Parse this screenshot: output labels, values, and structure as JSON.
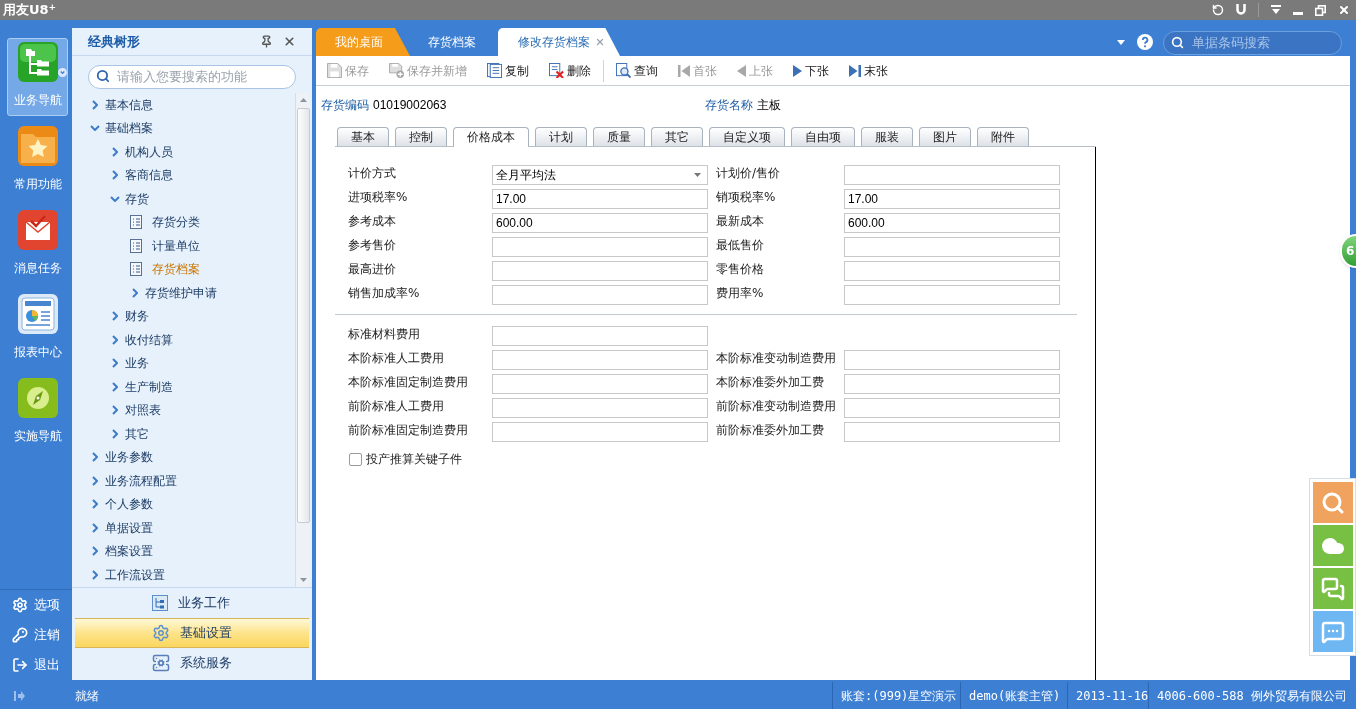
{
  "app": {
    "logo": "用友U8$^{+}$"
  },
  "nav": [
    {
      "label": "业务导航",
      "kind": "business",
      "selected": true
    },
    {
      "label": "常用功能",
      "kind": "favorites",
      "selected": false
    },
    {
      "label": "消息任务",
      "kind": "messages",
      "selected": false
    },
    {
      "label": "报表中心",
      "kind": "reports",
      "selected": false
    },
    {
      "label": "实施导航",
      "kind": "guide",
      "selected": false
    }
  ],
  "nav_bottom": [
    {
      "label": "选项",
      "kind": "options"
    },
    {
      "label": "注销",
      "kind": "logout"
    },
    {
      "label": "退出",
      "kind": "exit"
    }
  ],
  "sidebar": {
    "title": "经典树形",
    "search": {
      "placeholder": "请输入您要搜索的功能"
    },
    "tree": [
      {
        "label": "基本信息",
        "kind": "folder",
        "expanded": false,
        "selected": false
      },
      {
        "label": "基础档案",
        "kind": "folder",
        "expanded": true,
        "selected": false,
        "children": [
          {
            "label": "机构人员",
            "kind": "folder",
            "expanded": false,
            "selected": false
          },
          {
            "label": "客商信息",
            "kind": "folder",
            "expanded": false,
            "selected": false
          },
          {
            "label": "存货",
            "kind": "folder",
            "expanded": true,
            "selected": false,
            "children": [
              {
                "label": "存货分类",
                "kind": "page",
                "selected": false
              },
              {
                "label": "计量单位",
                "kind": "page",
                "selected": false
              },
              {
                "label": "存货档案",
                "kind": "page",
                "selected": true
              },
              {
                "label": "存货维护申请",
                "kind": "folder",
                "expanded": false,
                "selected": false
              }
            ]
          },
          {
            "label": "财务",
            "kind": "folder",
            "expanded": false,
            "selected": false
          },
          {
            "label": "收付结算",
            "kind": "folder",
            "expanded": false,
            "selected": false
          },
          {
            "label": "业务",
            "kind": "folder",
            "expanded": false,
            "selected": false
          },
          {
            "label": "生产制造",
            "kind": "folder",
            "expanded": false,
            "selected": false
          },
          {
            "label": "对照表",
            "kind": "folder",
            "expanded": false,
            "selected": false
          },
          {
            "label": "其它",
            "kind": "folder",
            "expanded": false,
            "selected": false
          }
        ]
      },
      {
        "label": "业务参数",
        "kind": "folder",
        "expanded": false,
        "selected": false
      },
      {
        "label": "业务流程配置",
        "kind": "folder",
        "expanded": false,
        "selected": false
      },
      {
        "label": "个人参数",
        "kind": "folder",
        "expanded": false,
        "selected": false
      },
      {
        "label": "单据设置",
        "kind": "folder",
        "expanded": false,
        "selected": false
      },
      {
        "label": "档案设置",
        "kind": "folder",
        "expanded": false,
        "selected": false
      },
      {
        "label": "工作流设置",
        "kind": "folder",
        "expanded": false,
        "selected": false
      }
    ],
    "sections": [
      {
        "label": "业务工作",
        "kind": "work",
        "selected": false
      },
      {
        "label": "基础设置",
        "kind": "settings",
        "selected": true
      },
      {
        "label": "系统服务",
        "kind": "service",
        "selected": false
      }
    ]
  },
  "tabs": [
    {
      "label": "我的桌面",
      "kind": "home",
      "selected": false
    },
    {
      "label": "存货档案",
      "kind": "page",
      "selected": false
    },
    {
      "label": "修改存货档案",
      "kind": "page",
      "selected": true,
      "closable": true
    }
  ],
  "bill_search": {
    "placeholder": "单据条码搜索"
  },
  "toolbar": {
    "groups": [
      [
        {
          "label": "保存",
          "kind": "save",
          "disabled": true
        },
        {
          "label": "保存并新增",
          "kind": "save_new",
          "disabled": true
        },
        {
          "label": "复制",
          "kind": "copy",
          "disabled": false
        },
        {
          "label": "删除",
          "kind": "delete",
          "disabled": false
        }
      ],
      [
        {
          "label": "查询",
          "kind": "query",
          "disabled": false
        },
        {
          "label": "首张",
          "kind": "first",
          "disabled": true
        },
        {
          "label": "上张",
          "kind": "prev",
          "disabled": true
        },
        {
          "label": "下张",
          "kind": "next",
          "disabled": false
        },
        {
          "label": "末张",
          "kind": "last",
          "disabled": false
        }
      ]
    ]
  },
  "record": {
    "fields": [
      {
        "label": "存货编码",
        "value": "01019002063"
      },
      {
        "label": "存货名称",
        "value": "主板"
      }
    ]
  },
  "subtabs": [
    {
      "label": "基本",
      "selected": false
    },
    {
      "label": "控制",
      "selected": false
    },
    {
      "label": "价格成本",
      "selected": true
    },
    {
      "label": "计划",
      "selected": false
    },
    {
      "label": "质量",
      "selected": false
    },
    {
      "label": "其它",
      "selected": false
    },
    {
      "label": "自定义项",
      "selected": false
    },
    {
      "label": "自由项",
      "selected": false
    },
    {
      "label": "服装",
      "selected": false
    },
    {
      "label": "图片",
      "selected": false
    },
    {
      "label": "附件",
      "selected": false
    }
  ],
  "form": {
    "sections": [
      {
        "rows": [
          [
            {
              "label": "计价方式",
              "kind": "select",
              "value": "全月平均法"
            },
            {
              "label": "计划价/售价",
              "kind": "text"
            }
          ],
          [
            {
              "label": "进项税率%",
              "kind": "text",
              "value": "17.00"
            },
            {
              "label": "销项税率%",
              "kind": "text",
              "value": "17.00"
            }
          ],
          [
            {
              "label": "参考成本",
              "kind": "text",
              "value": "600.00"
            },
            {
              "label": "最新成本",
              "kind": "text",
              "value": "600.00"
            }
          ],
          [
            {
              "label": "参考售价",
              "kind": "text"
            },
            {
              "label": "最低售价",
              "kind": "text"
            }
          ],
          [
            {
              "label": "最高进价",
              "kind": "text"
            },
            {
              "label": "零售价格",
              "kind": "text"
            }
          ],
          [
            {
              "label": "销售加成率%",
              "kind": "text"
            },
            {
              "label": "费用率%",
              "kind": "text"
            }
          ]
        ]
      },
      {
        "rows": [
          [
            {
              "label": "标准材料费用",
              "kind": "text"
            }
          ],
          [
            {
              "label": "本阶标准人工费用",
              "kind": "text"
            },
            {
              "label": "本阶标准变动制造费用",
              "kind": "text"
            }
          ],
          [
            {
              "label": "本阶标准固定制造费用",
              "kind": "text"
            },
            {
              "label": "本阶标准委外加工费",
              "kind": "text"
            }
          ],
          [
            {
              "label": "前阶标准人工费用",
              "kind": "text"
            },
            {
              "label": "前阶标准变动制造费用",
              "kind": "text"
            }
          ],
          [
            {
              "label": "前阶标准固定制造费用",
              "kind": "text"
            },
            {
              "label": "前阶标准委外加工费",
              "kind": "text"
            }
          ]
        ]
      }
    ],
    "checkbox": {
      "label": "投产推算关键子件",
      "checked": false
    }
  },
  "side_tools": [
    {
      "kind": "search",
      "color": "#f0a35e"
    },
    {
      "kind": "cloud",
      "color": "#78c043"
    },
    {
      "kind": "chat",
      "color": "#78c043"
    },
    {
      "kind": "message",
      "color": "#6fb7f2"
    }
  ],
  "badge": {
    "text": "6"
  },
  "status_bar": {
    "status": "就绪",
    "segments": [
      "账套:(999)星空演示",
      "demo(账套主管)",
      "2013-11-16",
      "4006-600-588 例外贸易有限公司"
    ]
  }
}
